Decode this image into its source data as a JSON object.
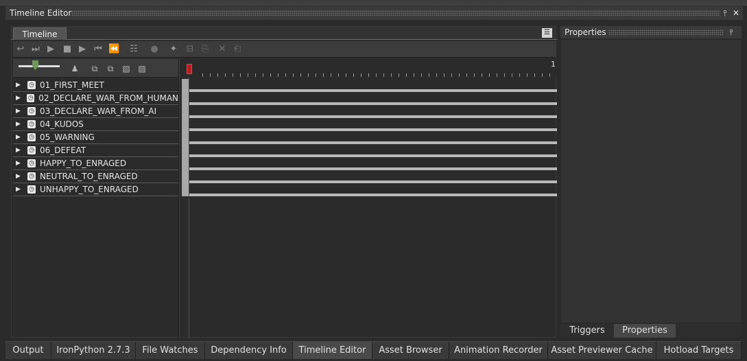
{
  "window": {
    "title": "Timeline Editor",
    "pin_icon": "pin-icon",
    "close_icon": "close-icon"
  },
  "timeline_panel": {
    "tab_label": "Timeline",
    "toolbar_icons": [
      "record-icon",
      "skip-end-icon",
      "step-forward-icon",
      "stop-icon",
      "play-icon",
      "step-back-icon",
      "skip-start-icon",
      "add-track-icon",
      "keyframe-icon",
      "add-clip-icon",
      "split-icon",
      "copy-icon",
      "delete-icon",
      "paste-icon"
    ],
    "ruler_end_label": "1",
    "tracks": [
      {
        "label": "01_FIRST_MEET"
      },
      {
        "label": "02_DECLARE_WAR_FROM_HUMAN"
      },
      {
        "label": "03_DECLARE_WAR_FROM_AI"
      },
      {
        "label": "04_KUDOS"
      },
      {
        "label": "05_WARNING"
      },
      {
        "label": "06_DEFEAT"
      },
      {
        "label": "HAPPY_TO_ENRAGED"
      },
      {
        "label": "NEUTRAL_TO_ENRAGED"
      },
      {
        "label": "UNHAPPY_TO_ENRAGED"
      }
    ]
  },
  "properties_panel": {
    "title": "Properties",
    "tabs": [
      "Triggers",
      "Properties"
    ],
    "active_tab": "Properties"
  },
  "bottom_tabs": {
    "items": [
      "Output",
      "IronPython 2.7.3",
      "File Watches",
      "Dependency Info",
      "Timeline Editor",
      "Asset Browser",
      "Animation Recorder",
      "Asset Previewer Cache",
      "Hotload Targets"
    ],
    "active": "Timeline Editor"
  },
  "colors": {
    "background": "#2b2b2b",
    "playhead": "#b32222",
    "lane_bar": "#b9b9b9",
    "zoom_thumb": "#6f9a5a"
  }
}
